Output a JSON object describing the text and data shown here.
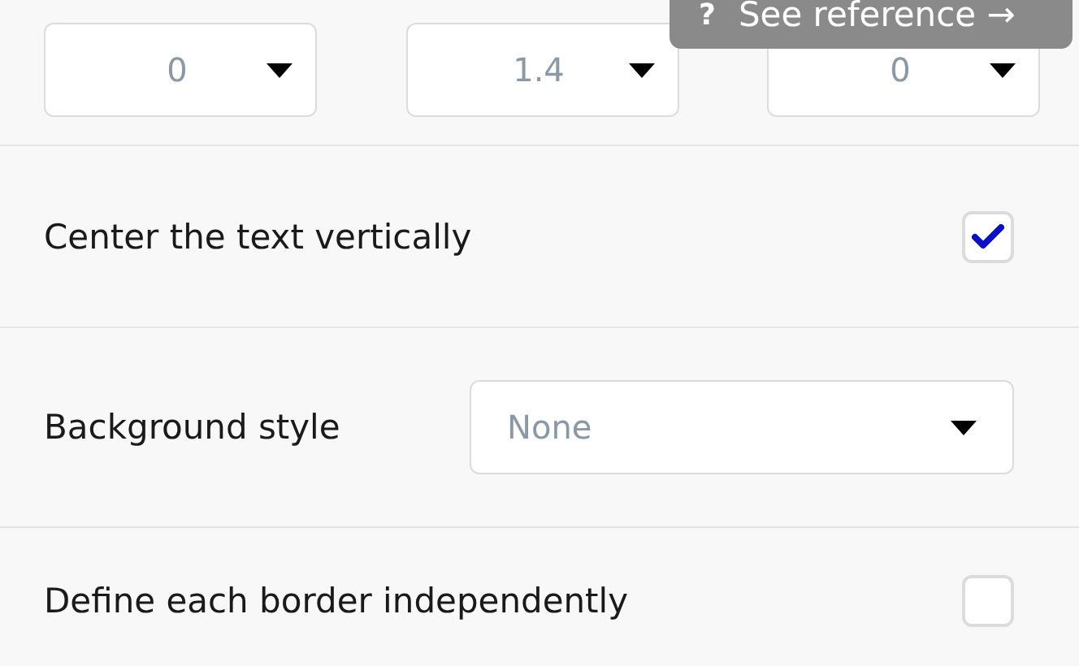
{
  "tooltip": {
    "icon": "?",
    "label": "See reference →"
  },
  "spacing_selects": [
    {
      "value": "0"
    },
    {
      "value": "1.4"
    },
    {
      "value": "0"
    }
  ],
  "rows": [
    {
      "kind": "checkbox",
      "label": "Center the text vertically",
      "checked": true
    },
    {
      "kind": "select",
      "label": "Background style",
      "value": "None"
    },
    {
      "kind": "checkbox",
      "label": "Define each border independently",
      "checked": false
    }
  ]
}
